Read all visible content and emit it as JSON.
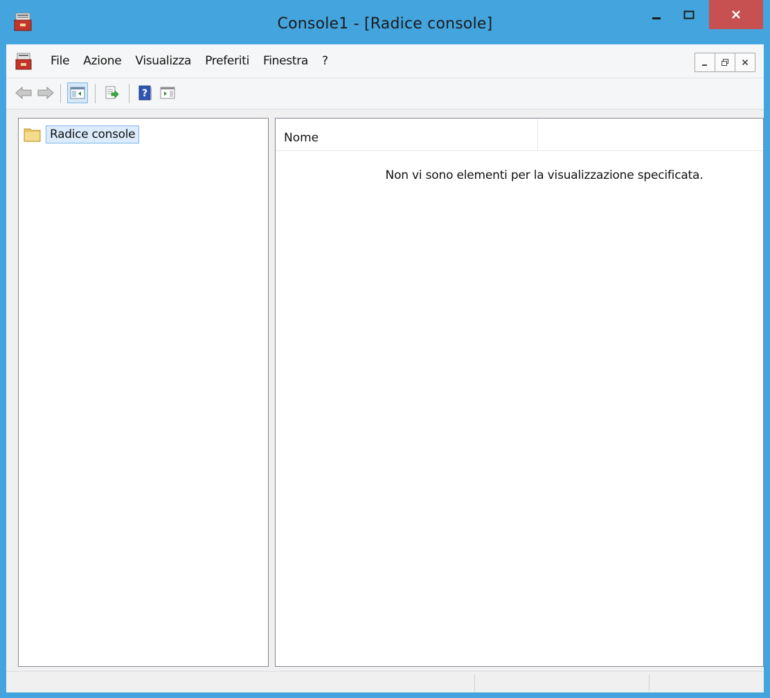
{
  "window": {
    "title": "Console1 - [Radice console]",
    "accent_color": "#43a4de",
    "close_color": "#c75050"
  },
  "menubar": {
    "items": [
      "File",
      "Azione",
      "Visualizza",
      "Preferiti",
      "Finestra",
      "?"
    ]
  },
  "toolbar": {
    "icons": [
      "back-arrow-icon",
      "forward-arrow-icon",
      "show-hide-console-tree-icon",
      "export-list-icon",
      "help-icon",
      "show-hide-action-pane-icon"
    ]
  },
  "tree": {
    "root_label": "Radice console"
  },
  "list": {
    "columns": [
      "Nome",
      ""
    ],
    "empty_message": "Non vi sono elementi per la visualizzazione specificata."
  }
}
